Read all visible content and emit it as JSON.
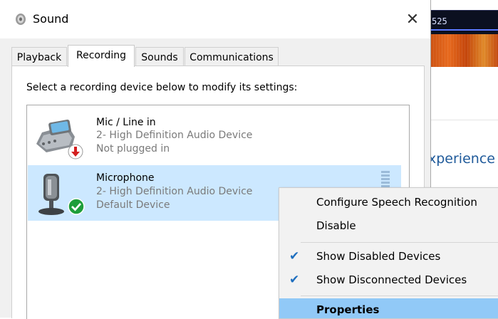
{
  "background_app": {
    "strip_number": "525",
    "heading_fragment": "xperience"
  },
  "dialog": {
    "title": "Sound",
    "close_symbol": "✕",
    "tabs": [
      {
        "label": "Playback"
      },
      {
        "label": "Recording",
        "active": true
      },
      {
        "label": "Sounds"
      },
      {
        "label": "Communications"
      }
    ],
    "instruction": "Select a recording device below to modify its settings:",
    "devices": [
      {
        "name": "Mic / Line in",
        "detail": "2- High Definition Audio Device",
        "status": "Not plugged in",
        "icon": "line-in-device-icon",
        "badge": "not-plugged-in-badge-icon"
      },
      {
        "name": "Microphone",
        "detail": "2- High Definition Audio Device",
        "status": "Default Device",
        "icon": "microphone-device-icon",
        "badge": "default-device-check-icon",
        "selected": true
      }
    ]
  },
  "context_menu": {
    "items": [
      {
        "label": "Configure Speech Recognition"
      },
      {
        "label": "Disable"
      },
      {
        "label": "Show Disabled Devices",
        "checked": true
      },
      {
        "label": "Show Disconnected Devices",
        "checked": true
      },
      {
        "label": "Properties",
        "highlighted": true,
        "bold": true
      }
    ],
    "check_symbol": "✔"
  },
  "colors": {
    "selection": "#cce8ff",
    "menu_highlight": "#91c9f7",
    "check": "#1f6fbf",
    "status_gray": "#7a7a7a",
    "badge_green": "#1e9e3a",
    "badge_red": "#d31f1f"
  }
}
